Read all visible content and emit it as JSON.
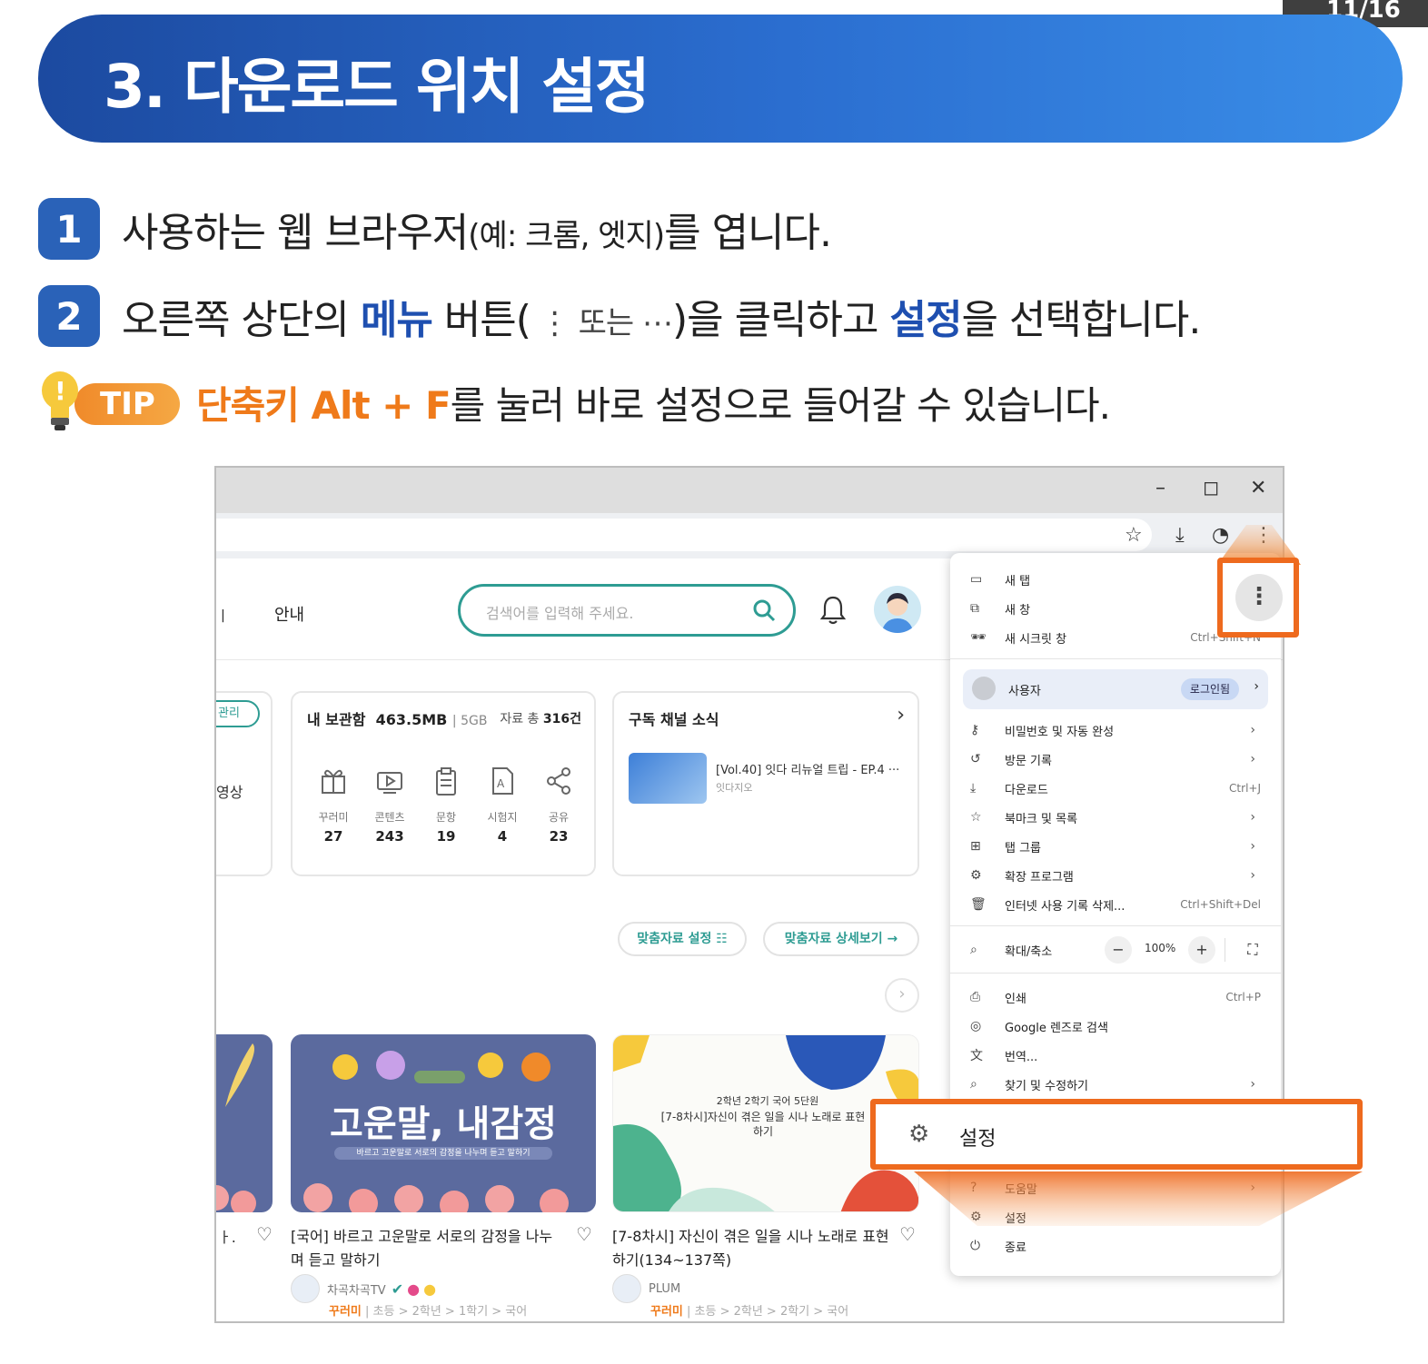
{
  "page_number": "11/16",
  "title": "3. 다운로드 위치 설정",
  "steps": [
    {
      "num": "1",
      "text_a": "사용하는 웹 브라우저",
      "text_b": "(예: 크롬, 엣지)",
      "text_c": "를 엽니다."
    },
    {
      "num": "2",
      "text_a": "오른쪽 상단의 ",
      "highlight_1": "메뉴",
      "text_b": " 버튼(",
      "text_c": " ⋮ 또는 ⋯",
      "text_d": ")을 클릭하고 ",
      "highlight_2": "설정",
      "text_e": "을 선택합니다."
    }
  ],
  "tip": {
    "badge": "TIP",
    "highlight": "단축키 Alt + F",
    "text": "를 눌러 바로 설정으로 들어갈 수 있습니다."
  },
  "screenshot": {
    "window_controls": [
      "–",
      "◻",
      "✕"
    ],
    "toolbar_icons": [
      "star-icon",
      "download-icon",
      "profile-icon",
      "kebab-menu-icon"
    ],
    "nav_fragment": "ㅣ",
    "nav_guide": "안내",
    "search_placeholder": "검색어를 입력해 주세요.",
    "left_card": {
      "pill": "관리",
      "text": "영상"
    },
    "storage": {
      "title": "내 보관함",
      "used": "463.5MB",
      "total": "5GB",
      "count_label": "자료 총",
      "count_value": "316건",
      "stats": [
        {
          "label": "꾸러미",
          "value": "27"
        },
        {
          "label": "콘텐츠",
          "value": "243"
        },
        {
          "label": "문항",
          "value": "19"
        },
        {
          "label": "시험지",
          "value": "4"
        },
        {
          "label": "공유",
          "value": "23"
        }
      ]
    },
    "subscribe": {
      "title": "구독 채널 소식",
      "item_title": "[Vol.40] 잇다 리뉴얼 트립 - EP.4 ···",
      "item_sub": "잇다지오"
    },
    "rec_buttons": [
      "맞춤자료 설정 ☷",
      "맞춤자료 상세보기 →"
    ],
    "thumb_caption_main": "고운말, 내감정",
    "thumb_caption_small": "바르고 고운말로 서로의 감정을 나누며 듣고 말하기",
    "thumb2_caption": "2학년 2학기 국어 5단원",
    "thumb2_caption_b": "[7-8차시]자신이 겪은 일을 시나 노래로 표현하기",
    "cards": [
      {
        "title": "[국어] 바르고 고운말로 서로의 감정을 나누며 듣고 말하기",
        "author": "차곡차곡TV",
        "tag": "꾸러미",
        "path": " | 초등 > 2학년 > 1학기 > 국어"
      },
      {
        "title": "[7-8차시] 자신이 겪은 일을 시나 노래로 표현하기(134~137쪽)",
        "author": "PLUM",
        "tag": "꾸러미",
        "path": " | 초등 > 2학년 > 2학기 > 국어"
      }
    ],
    "menu": {
      "items_top": [
        {
          "icon": "▭",
          "label": "새 탭",
          "right": ""
        },
        {
          "icon": "⧉",
          "label": "새 창",
          "right": ""
        },
        {
          "icon": "🕶",
          "label": "새 시크릿 창",
          "right": "Ctrl+Shift+N"
        }
      ],
      "user_label": "사용자",
      "login_label": "로그인됨",
      "items_mid": [
        {
          "icon": "⚷",
          "label": "비밀번호 및 자동 완성",
          "right": "›"
        },
        {
          "icon": "↺",
          "label": "방문 기록",
          "right": "›"
        },
        {
          "icon": "⤓",
          "label": "다운로드",
          "right": "Ctrl+J"
        },
        {
          "icon": "☆",
          "label": "북마크 및 목록",
          "right": "›"
        },
        {
          "icon": "⊞",
          "label": "탭 그룹",
          "right": "›"
        },
        {
          "icon": "⚙",
          "label": "확장 프로그램",
          "right": "›"
        },
        {
          "icon": "🗑",
          "label": "인터넷 사용 기록 삭제...",
          "right": "Ctrl+Shift+Del"
        }
      ],
      "zoom_label": "확대/축소",
      "zoom_value": "100%",
      "items_low": [
        {
          "icon": "⎙",
          "label": "인쇄",
          "right": "Ctrl+P"
        },
        {
          "icon": "◎",
          "label": "Google 렌즈로 검색",
          "right": ""
        },
        {
          "icon": "文",
          "label": "번역...",
          "right": ""
        },
        {
          "icon": "⌕",
          "label": "찾기 및 수정하기",
          "right": "›"
        }
      ],
      "items_bottom": [
        {
          "icon": "?",
          "label": "도움말",
          "right": "›"
        },
        {
          "icon": "⚙",
          "label": "설정",
          "right": ""
        },
        {
          "icon": "⏻",
          "label": "종료",
          "right": ""
        }
      ]
    },
    "settings_callout": "설정",
    "accent_color": "#ee6a1e",
    "brand_color": "#2e9c93"
  }
}
